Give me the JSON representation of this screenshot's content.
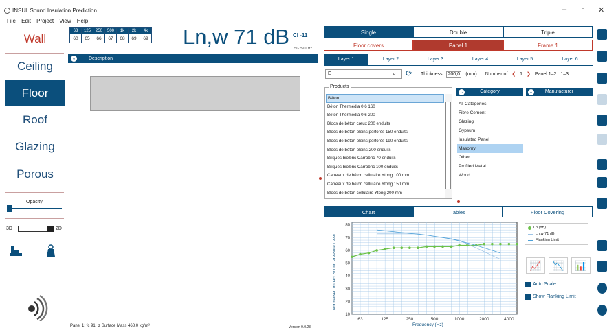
{
  "app": {
    "title": "INSUL Sound Insulation Prediction"
  },
  "menu": [
    "File",
    "Edit",
    "Project",
    "View",
    "Help"
  ],
  "window": {
    "minimize": "–",
    "restore": "▫",
    "close": "✕"
  },
  "nav": [
    "Wall",
    "Ceiling",
    "Floor",
    "Roof",
    "Glazing",
    "Porous"
  ],
  "nav_active": "Floor",
  "opacity_label": "Opacity",
  "view": {
    "left": "3D",
    "right": "2D"
  },
  "freq": {
    "headers": [
      "63",
      "125",
      "250",
      "500",
      "1k",
      "2k",
      "4k"
    ],
    "values": [
      "60",
      "65",
      "66",
      "67",
      "68",
      "69",
      "69"
    ]
  },
  "rating": {
    "main": "Ln,w 71 dB",
    "ci": "CI -11",
    "range": "50-2500 Hz"
  },
  "description": {
    "label": "Description"
  },
  "status": {
    "panel": "Panel 1: fc 91Hz Surface Mass 468,0 kg/m²",
    "version": "Version 9.0.23"
  },
  "tabs1": [
    "Single",
    "Double",
    "Triple"
  ],
  "tabs1_selected": "Single",
  "tabs2": [
    "Floor covers",
    "Panel 1",
    "Frame 1"
  ],
  "tabs2_selected": "Panel 1",
  "layers": [
    "Layer 1",
    "Layer 2",
    "Layer 3",
    "Layer 4",
    "Layer 5",
    "Layer 6"
  ],
  "layer_selected": "Layer 1",
  "search": {
    "value": "E"
  },
  "thickness": {
    "label": "Thickness",
    "value": "200,0",
    "unit": "(mm)"
  },
  "number_of": {
    "label": "Number of",
    "value": "1",
    "panel": "Panel 1–2",
    "range": "1–3"
  },
  "products": {
    "label": "Products",
    "items": [
      "Béton",
      "Béton Thermédia 0.6 160",
      "Béton Thermédia 0.6 200",
      "Blocs de béton creux 200 enduits",
      "Blocs de béton pleins perforés 150 enduits",
      "Blocs de béton pleins perforés 190 enduits",
      "Blocs de béton pleins 200 enduits",
      "Briques bio'bric Carrobric 70 enduits",
      "Briques bio'bric Carrobric 100 enduits",
      "Carreaux de béton cellulaire Ytong 100 mm",
      "Carreaux de béton cellulaire Ytong 150 mm",
      "Blocs de béton cellulaire Ytong 200 mm"
    ],
    "selected": "Béton"
  },
  "category": {
    "header": "Category",
    "items": [
      "All Categories",
      "Fibre Cement",
      "Glazing",
      "Gypsum",
      "Insulated Panel",
      "Masonry",
      "Other",
      "Profiled Metal",
      "Wood"
    ],
    "selected": "Masonry"
  },
  "manufacturer": {
    "header": "Manufacturer"
  },
  "bottom_tabs": [
    "Chart",
    "Tables",
    "Floor Covering"
  ],
  "bottom_selected": "Chart",
  "chart_legend": [
    "Ln (dB)",
    "Ln,w 71 dB",
    "Flanking Limit"
  ],
  "options": {
    "auto_scale": "Auto Scale",
    "show_flanking": "Show Flanking Limit"
  },
  "colors": {
    "accent": "#0b4f7c",
    "tab_red": "#b03a2e",
    "series": "#6dc24b"
  },
  "chart_data": {
    "type": "line",
    "xlabel": "Frequency (Hz)",
    "ylabel": "Normalised Impact Sound Pressure Level",
    "x_ticks": [
      "63",
      "125",
      "250",
      "500",
      "1000",
      "2000",
      "4000"
    ],
    "y_ticks": [
      "10",
      "20",
      "30",
      "40",
      "50",
      "60",
      "70",
      "80"
    ],
    "ylim": [
      10,
      82
    ],
    "x_log": true,
    "xlim": [
      50,
      5000
    ],
    "series": [
      {
        "name": "Ln (dB)",
        "x": [
          50,
          63,
          80,
          100,
          125,
          160,
          200,
          250,
          315,
          400,
          500,
          630,
          800,
          1000,
          1250,
          1600,
          2000,
          2500,
          3150,
          4000,
          5000
        ],
        "y": [
          55,
          57,
          58,
          60,
          61,
          62,
          62,
          62,
          62,
          63,
          63,
          63,
          63,
          64,
          64,
          64,
          65,
          65,
          65,
          65,
          65
        ]
      },
      {
        "name": "Ln,w 71 dB",
        "x": [
          100,
          125,
          160,
          200,
          250,
          315,
          400,
          500,
          630,
          800,
          1000,
          1250,
          1600,
          2000,
          2500,
          3150
        ],
        "y": [
          73,
          73,
          73,
          73,
          73,
          73,
          72,
          71,
          70,
          69,
          68,
          65,
          62,
          59,
          56,
          53
        ]
      },
      {
        "name": "Flanking Limit",
        "x": [
          100,
          200,
          400,
          800,
          1600,
          3150
        ],
        "y": [
          76,
          74,
          72,
          69,
          64,
          58
        ]
      }
    ],
    "grid": true
  }
}
